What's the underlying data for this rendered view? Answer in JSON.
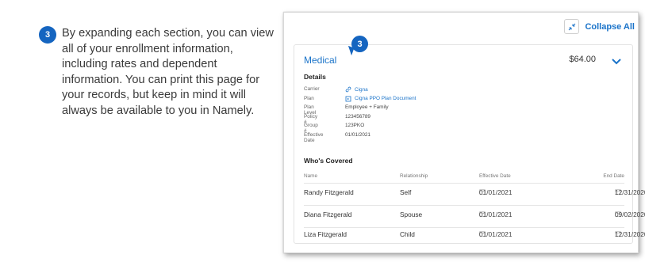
{
  "step_number": "3",
  "instructions": "By expanding each section, you can view all of your enrollment information, including rates and dependent information. You can print this page for your records, but keep in mind it will always be available to you in Namely.",
  "panel": {
    "collapse_all_label": "Collapse All",
    "card": {
      "title": "Medical",
      "amount": "$64.00",
      "details_heading": "Details",
      "details": {
        "carrier": {
          "label": "Carrier",
          "value": "Cigna"
        },
        "plan": {
          "label": "Plan",
          "value": "Cigna PPO Plan Document"
        },
        "plan_level": {
          "label": "Plan Level",
          "value": "Employee + Family"
        },
        "policy": {
          "label": "Policy #",
          "value": "123456789"
        },
        "group": {
          "label": "Group #",
          "value": "123PKO"
        },
        "effective_date": {
          "label": "Effective Date",
          "value": "01/01/2021"
        }
      },
      "coverage_heading": "Who's Covered",
      "coverage_columns": {
        "name": "Name",
        "relationship": "Relationship",
        "effective_date": "Effective Date",
        "end_date": "End Date"
      },
      "coverage_rows": [
        {
          "name": "Randy Fitzgerald",
          "relationship": "Self",
          "effective_date": "01/01/2021",
          "end_date": "12/31/2020"
        },
        {
          "name": "Diana Fitzgerald",
          "relationship": "Spouse",
          "effective_date": "01/01/2021",
          "end_date": "09/02/2020"
        },
        {
          "name": "Liza Fitzgerald",
          "relationship": "Child",
          "effective_date": "01/01/2021",
          "end_date": "12/31/2020"
        }
      ]
    }
  },
  "colors": {
    "accent": "#1a73c9",
    "badge": "#1565c0"
  },
  "icons": [
    "collapse-arrows-icon",
    "chevron-down-icon",
    "link-icon",
    "document-icon",
    "calendar-icon"
  ]
}
